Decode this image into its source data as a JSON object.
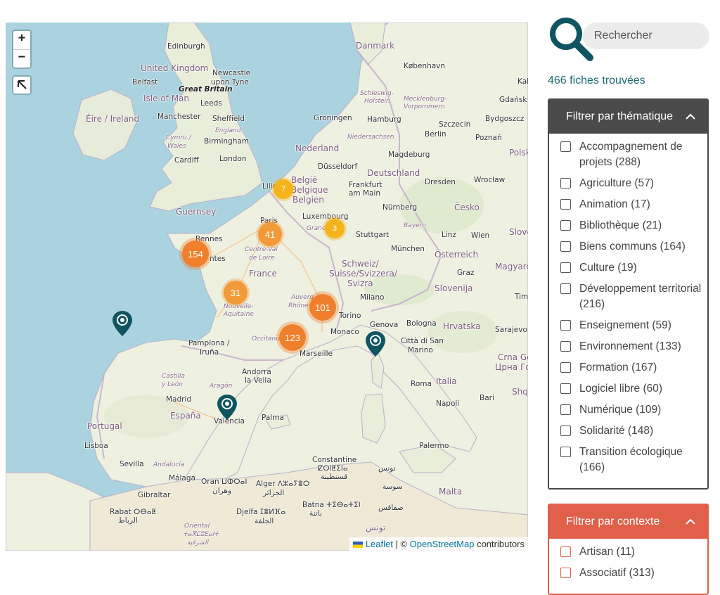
{
  "map": {
    "zoom_in": "+",
    "zoom_out": "−",
    "labels": {
      "edinburgh": "Edinburgh",
      "uk": "United Kingdom",
      "newcastle": "Newcastle",
      "upon_tyne": "upon Tyne",
      "belfast": "Belfast",
      "great_britain": "Great Britain",
      "isle_of_man": "Isle of Man",
      "leeds": "Leeds",
      "eire": "Éire / Ireland",
      "manchester": "Manchester",
      "sheffield": "Sheffield",
      "england": "England",
      "cymru": "Cymru /",
      "wales": "Wales",
      "birmingham": "Birmingham",
      "cardiff": "Cardiff",
      "london": "London",
      "guernsey": "Guernsey",
      "danmark": "Danmark",
      "kobenhavn": "København",
      "schleswig": "Schleswig-",
      "holstein": "Holstein",
      "mecklenburg": "Mecklenburg-",
      "vorpommern": "Vorpommern",
      "gdansk": "Gdańsk",
      "groningen": "Groningen",
      "hamburg": "Hamburg",
      "szczecin": "Szczecin",
      "bydgoszcz": "Bydgoszcz",
      "niedersachsen": "Niedersachsen",
      "berlin": "Berlin",
      "poznan": "Poznań",
      "nederland": "Nederland",
      "magdeburg": "Magdeburg",
      "polska": "Polsk",
      "dusseldorf": "Düsseldorf",
      "deutschland": "Deutschland",
      "lille": "Lille",
      "belgie": "België",
      "belgique": "Belgique",
      "belgien": "Belgien",
      "frankfurt": "Frankfurt",
      "am_main": "am Main",
      "dresden": "Dresden",
      "wroclaw": "Wrocław",
      "cesko": "Česko",
      "luxembourg": "Luxembourg",
      "nurnberg": "Nürnberg",
      "paris": "Paris",
      "grand_est": "Grand",
      "bayern": "Bayern",
      "stuttgart": "Stuttgart",
      "linz": "Linz",
      "wien": "Wien",
      "slove": "Slove",
      "rennes": "Rennes",
      "nantes": "ntes",
      "centre_val": "Centre-Val",
      "de_loire": "de Loire",
      "munchen": "München",
      "osterreich": "Österreich",
      "magyaro": "Magyaro",
      "france": "France",
      "schweiz": "Schweiz/",
      "suisse": "Suisse/Svizzera/",
      "svizra": "Svizra",
      "graz": "Graz",
      "nouvelle": "Nouvelle-",
      "aquitaine": "Aquitaine",
      "slovenija": "Slovenija",
      "auvergne": "Auverg",
      "rhone": "Rhône-",
      "milano": "Milano",
      "tim": "Tim",
      "torino": "Torino",
      "hrvatska": "Hrvatska",
      "sarajevo": "Sarajevo",
      "monaco": "Monaco",
      "genova": "Genova",
      "bologna": "Bologna",
      "pamplona": "Pamplona /",
      "iruna": "Iruña",
      "occitanie": "Occitanie",
      "citta_san": "Città di San",
      "marino": "Marino",
      "crna_go": "Crna Go",
      "crna_cyr": "Црна Гор",
      "marseille": "Marseille",
      "andorra": "Andorra",
      "la_vella": "la Vella",
      "castilla": "Castilla",
      "y_leon": "y León",
      "aragon": "Aragón",
      "roma": "Roma",
      "italia": "Italia",
      "shq": "Shq",
      "madrid": "Madrid",
      "espana": "España",
      "napoli": "Napoli",
      "bari": "Bari",
      "portugal": "Portugal",
      "valencia": "València",
      "palma": "Palma",
      "lisboa": "Lisboa",
      "palermo": "Palermo",
      "sevilla": "Sevilla",
      "andalucia": "Andalucía",
      "constantine": "Constantine",
      "constantine_ber": "ⵇⵙⵏⵟⵉⵏⴰ",
      "tunis": "تونس",
      "qsentina": "قسنطينة",
      "malaga": "Málaga",
      "oran": "Oran ⵡⵀⵔⴰⵏ",
      "wahran": "وهران",
      "alger": "Alger ⴷⵣⴰⵢⴻⵔ",
      "jazair": "الجزائر",
      "sousse": "سوسة",
      "gibraltar": "Gibraltar",
      "malta": "Malta",
      "batna": "Batna ⵜⵉⴱⴰⵜⵉⵏ",
      "batna_ar": "باتنة",
      "sfax": "صفاقس",
      "rabat": "Rabat ⵔⴱⴰⵟ",
      "rabat_ar": "الرباط",
      "djelfa": "Djelfa ⵊⴻⵍⴼⴰ",
      "djelfa_ar": "الجلفة",
      "tunisie": "تونس",
      "oriental": "Oriental",
      "oriental_ber": "ⵜⴰⴳⵎⵓⴹⴰⵏⵜ",
      "sharqiya": "الشرقية",
      "kal": "Kal"
    },
    "clusters": [
      {
        "id": "lille",
        "count": "7"
      },
      {
        "id": "paris",
        "count": "41"
      },
      {
        "id": "grand-est",
        "count": "3"
      },
      {
        "id": "rennes",
        "count": "154"
      },
      {
        "id": "nouvelle-aquitaine",
        "count": "31"
      },
      {
        "id": "auvergne",
        "count": "101"
      },
      {
        "id": "occitanie",
        "count": "123"
      }
    ],
    "attribution": {
      "leaflet": "Leaflet",
      "separator": " | © ",
      "osm": "OpenStreetMap",
      "contributors": " contributors"
    }
  },
  "search": {
    "placeholder": "Rechercher"
  },
  "results": {
    "count_text": "466 fiches trouvées"
  },
  "filters": {
    "thematique": {
      "title": "Filtrer par thématique",
      "options": [
        "Accompagnement de projets (288)",
        "Agriculture (57)",
        "Animation (17)",
        "Bibliothèque (21)",
        "Biens communs (164)",
        "Culture (19)",
        "Développement territorial (216)",
        "Enseignement (59)",
        "Environnement (133)",
        "Formation (167)",
        "Logiciel libre (60)",
        "Numérique (109)",
        "Solidarité (148)",
        "Transition écologique (166)"
      ]
    },
    "contexte": {
      "title": "Filtrer par contexte",
      "options": [
        "Artisan (11)",
        "Associatif (313)"
      ]
    }
  },
  "colors": {
    "accent_teal": "#1b6b74",
    "panel_dark": "#4a4a4a",
    "panel_context": "#e0604a",
    "cluster_big": "#f07f2b",
    "cluster_small": "#f5b31c"
  },
  "icons": {
    "search": "search-icon",
    "chevron": "chevron-up-icon",
    "reset": "arrow-up-left-icon",
    "pin": "map-pin-icon"
  }
}
